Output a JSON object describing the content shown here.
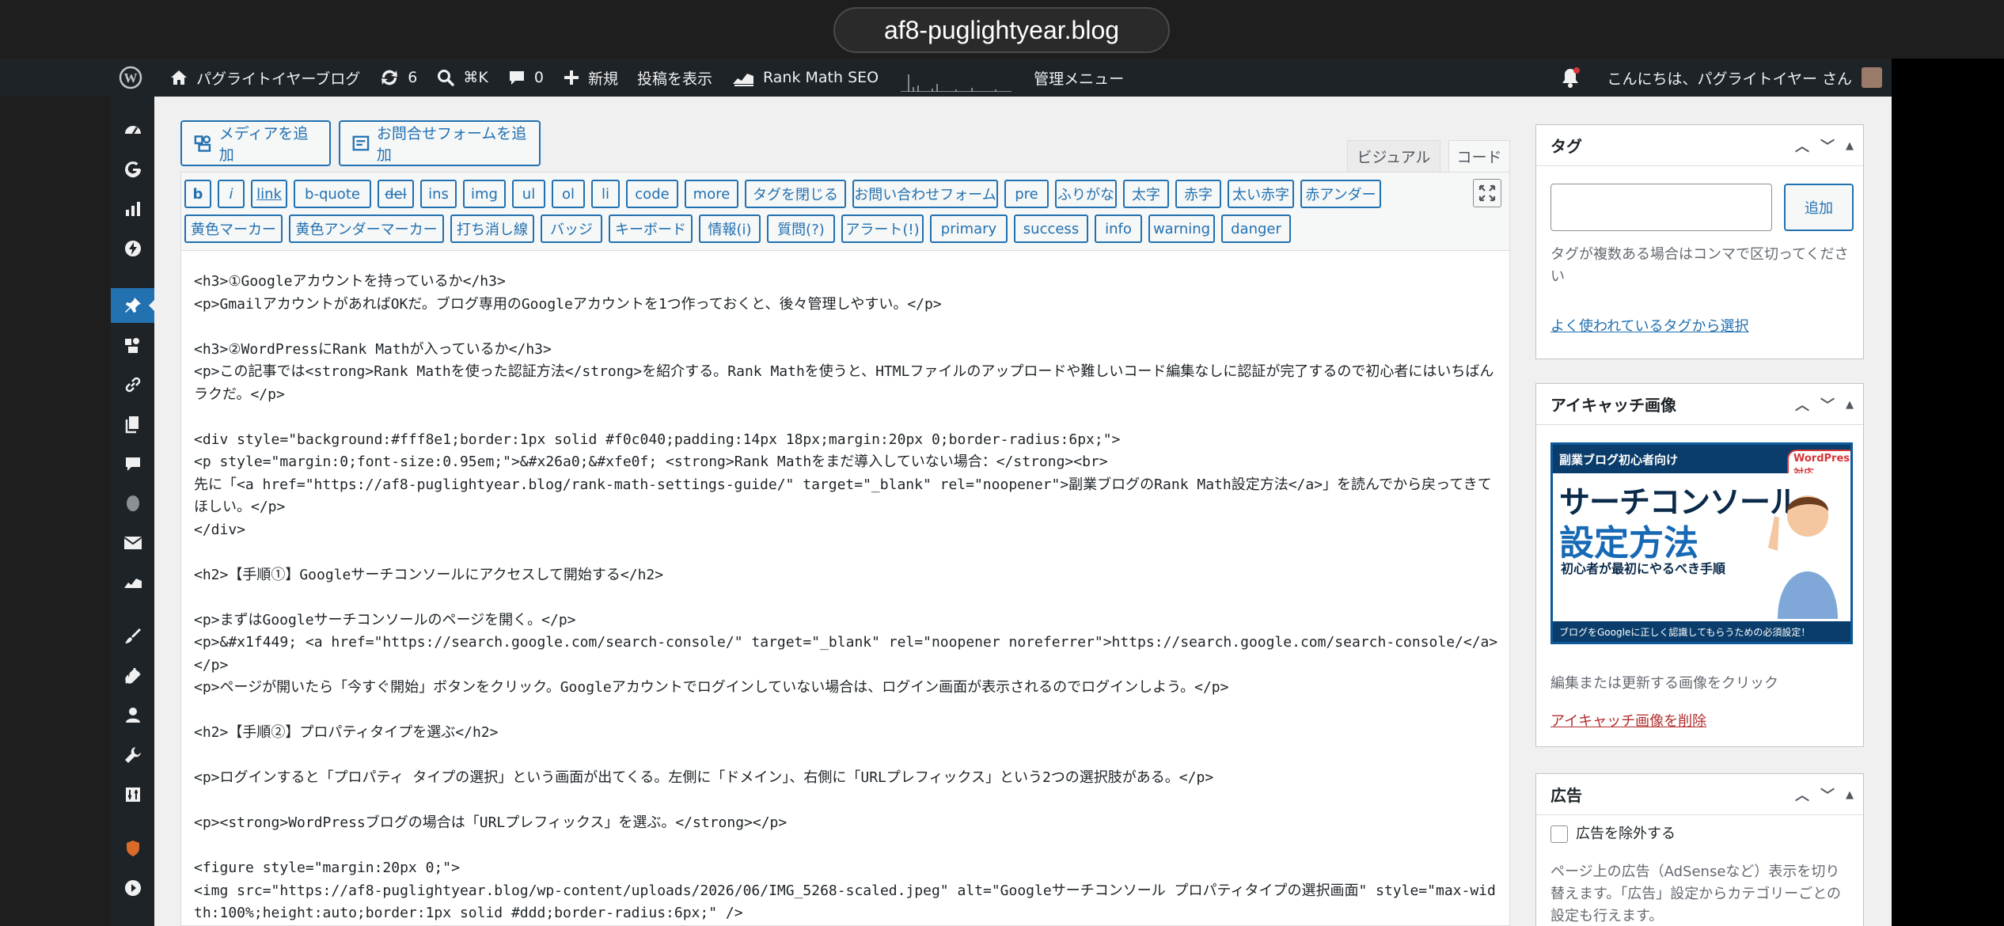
{
  "browser": {
    "url": "af8-puglightyear.blog"
  },
  "adminbar": {
    "site_name": "パグライトイヤーブログ",
    "updates_count": "6",
    "search_shortcut": "⌘K",
    "comments_count": "0",
    "new_label": "新規",
    "view_post": "投稿を表示",
    "rank_math": "Rank Math SEO",
    "admin_menu": "管理メニュー",
    "greeting": "こんにちは、パグライトイヤー さん"
  },
  "editor": {
    "add_media": "メディアを追加",
    "add_form": "お問合せフォームを追加",
    "tab_visual": "ビジュアル",
    "tab_code": "コード",
    "buttons_row1": [
      "b",
      "i",
      "link",
      "b-quote",
      "del",
      "ins",
      "img",
      "ul",
      "ol",
      "li",
      "code",
      "more",
      "タグを閉じる",
      "お問い合わせフォーム",
      "pre",
      "ふりがな",
      "太字",
      "赤字",
      "太い赤字",
      "赤アンダー"
    ],
    "buttons_row2": [
      "黄色マーカー",
      "黄色アンダーマーカー",
      "打ち消し線",
      "バッジ",
      "キーボード",
      "情報(i)",
      "質問(?)",
      "アラート(!)",
      "primary",
      "success",
      "info",
      "warning",
      "danger"
    ],
    "code_lines": [
      "<h3>①Googleアカウントを持っているか</h3>",
      "<p>GmailアカウントがあればOKだ。ブログ専用のGoogleアカウントを1つ作っておくと、後々管理しやすい。</p>",
      "",
      "<h3>②WordPressにRank Mathが入っているか</h3>",
      "<p>この記事では<strong>Rank Mathを使った認証方法</strong>を紹介する。Rank Mathを使うと、HTMLファイルのアップロードや難しいコード編集なしに認証が完了するので初心者にはいちばんラクだ。</p>",
      "",
      "<div style=\"background:#fff8e1;border:1px solid #f0c040;padding:14px 18px;margin:20px 0;border-radius:6px;\">",
      "<p style=\"margin:0;font-size:0.95em;\">&#x26a0;&#xfe0f; <strong>Rank Mathをまだ導入していない場合：</strong><br>",
      "先に「<a href=\"https://af8-puglightyear.blog/rank-math-settings-guide/\" target=\"_blank\" rel=\"noopener\">副業ブログのRank Math設定方法</a>」を読んでから戻ってきてほしい。</p>",
      "</div>",
      "",
      "<h2>【手順①】Googleサーチコンソールにアクセスして開始する</h2>",
      "",
      "<p>まずはGoogleサーチコンソールのページを開く。</p>",
      "<p>&#x1f449; <a href=\"https://search.google.com/search-console/\" target=\"_blank\" rel=\"noopener noreferrer\">https://search.google.com/search-console/</a></p>",
      "<p>ページが開いたら「今すぐ開始」ボタンをクリック。Googleアカウントでログインしていない場合は、ログイン画面が表示されるのでログインしよう。</p>",
      "",
      "<h2>【手順②】プロパティタイプを選ぶ</h2>",
      "",
      "<p>ログインすると「プロパティ タイプの選択」という画面が出てくる。左側に「ドメイン」、右側に「URLプレフィックス」という2つの選択肢がある。</p>",
      "",
      "<p><strong>WordPressブログの場合は「URLプレフィックス」を選ぶ。</strong></p>",
      "",
      "<figure style=\"margin:20px 0;\">",
      "<img src=\"https://af8-puglightyear.blog/wp-content/uploads/2026/06/IMG_5268-scaled.jpeg\" alt=\"Googleサーチコンソール プロパティタイプの選択画面\" style=\"max-width:100%;height:auto;border:1px solid #ddd;border-radius:6px;\" />"
    ]
  },
  "tags_box": {
    "title": "タグ",
    "add": "追加",
    "help": "タグが複数ある場合はコンマで区切ってください",
    "popular_link": "よく使われているタグから選択"
  },
  "eyecatch_box": {
    "title": "アイキャッチ画像",
    "img_top": "副業ブログ初心者向け",
    "img_badge": "WordPress対応",
    "img_title1": "サーチコンソール",
    "img_title2": "設定方法",
    "img_sub": "初心者が最初にやるべき手順",
    "img_bottom": "ブログをGoogleに正しく認識してもらうための必須設定！",
    "help": "編集または更新する画像をクリック",
    "remove_link": "アイキャッチ画像を削除"
  },
  "ad_box": {
    "title": "広告",
    "exclude_label": "広告を除外する",
    "help": "ページ上の広告（AdSenseなど）表示を切り替えます。「広告」設定からカテゴリーごとの設定も行えます。"
  }
}
